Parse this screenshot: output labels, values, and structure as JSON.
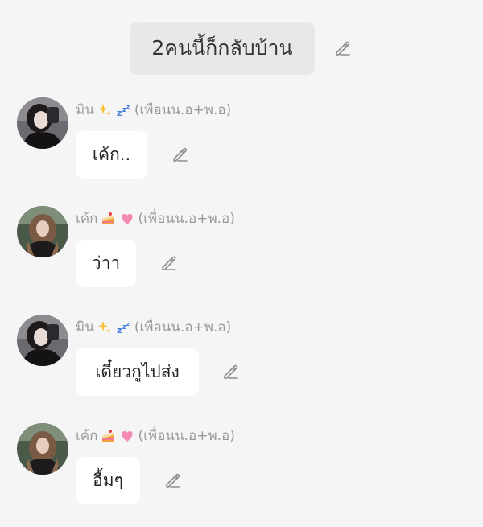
{
  "chat_title": "2คนนี้ก็กลับบ้าน",
  "messages": [
    {
      "sender_name": "มิน",
      "sender_suffix": "(เพื่อนน.อ+พ.อ)",
      "text": "เค้ก..",
      "emojis": [
        "sparkles-emoji",
        "zzz-emoji"
      ],
      "avatar": "avatar-min"
    },
    {
      "sender_name": "เค้ก",
      "sender_suffix": "(เพื่อนน.อ+พ.อ)",
      "text": "ว่าา",
      "emojis": [
        "cake-emoji",
        "pink-heart-emoji"
      ],
      "avatar": "avatar-cake"
    },
    {
      "sender_name": "มิน",
      "sender_suffix": "(เพื่อนน.อ+พ.อ)",
      "text": "เดี๋ยวกูไปส่ง",
      "emojis": [
        "sparkles-emoji",
        "zzz-emoji"
      ],
      "avatar": "avatar-min"
    },
    {
      "sender_name": "เค้ก",
      "sender_suffix": "(เพื่อนน.อ+พ.อ)",
      "text": "อื้มๆ",
      "emojis": [
        "cake-emoji",
        "pink-heart-emoji"
      ],
      "avatar": "avatar-cake"
    }
  ],
  "colors": {
    "background": "#f5f5f5",
    "header_pill": "#e8e8e8",
    "bubble": "#ffffff",
    "sender_text": "#9a9a9a",
    "icon": "#9a9a9a"
  },
  "icons": {
    "edit": "pencil-edit-icon"
  }
}
